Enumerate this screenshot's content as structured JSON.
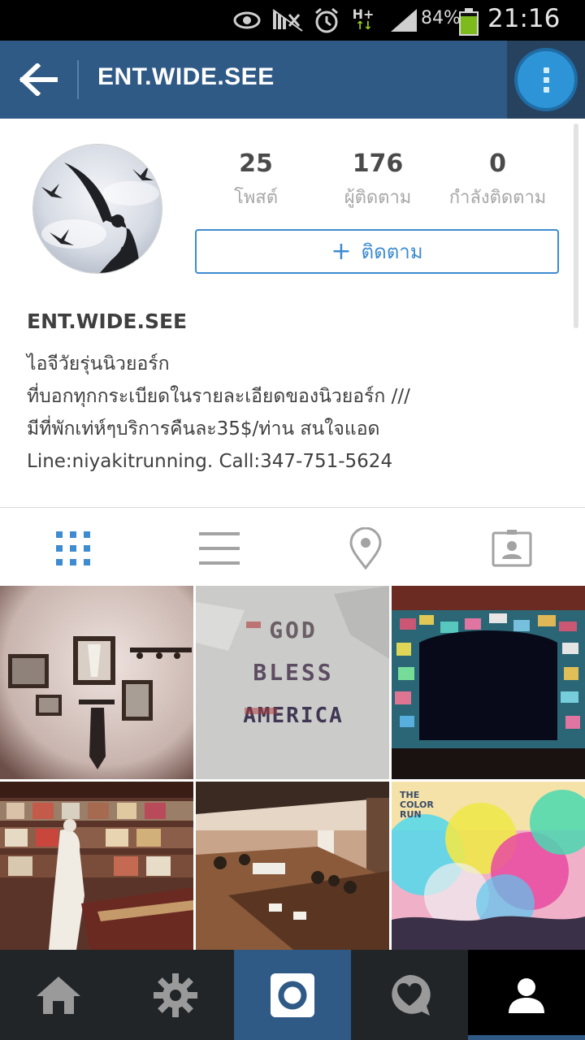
{
  "status_bar": {
    "network": "H+",
    "battery_percent": "84%",
    "battery_level": 0.84,
    "time": "21:16"
  },
  "header": {
    "title": "ENT.WIDE.SEE",
    "back_icon": "arrow-left-icon",
    "menu_icon": "more-vert-icon",
    "color": "#2f5a86"
  },
  "profile": {
    "stats": {
      "posts_count": "25",
      "posts_label": "โพสต์",
      "followers_count": "176",
      "followers_label": "ผู้ติดตาม",
      "following_count": "0",
      "following_label": "กำลังติดตาม"
    },
    "follow_button": {
      "icon": "+",
      "label": "ติดตาม"
    },
    "name": "ENT.WIDE.SEE",
    "bio": [
      "ไอจีวัยรุ่นนิวยอร์ก",
      "ที่บอกทุกกระเบียดในรายละเอียดของนิวยอร์ก ///",
      "มีที่พักเท่ห์ๆบริการคืนละ35$/ท่าน สนใจแอด",
      "Line:niyakitrunning. Call:347-751-5624"
    ],
    "accent_color": "#3d8bd0"
  },
  "tabs": [
    {
      "icon": "grid-icon",
      "selected": true
    },
    {
      "icon": "list-icon",
      "selected": false
    },
    {
      "icon": "map-pin-icon",
      "selected": false
    },
    {
      "icon": "tagged-photos-icon",
      "selected": false
    }
  ],
  "grid": {
    "post_2_text": [
      "GOD",
      "BLESS",
      "AMERICA"
    ],
    "post_6_text": [
      "THE",
      "COLOR",
      "RUN"
    ]
  },
  "bottom_nav": [
    {
      "icon": "home-icon"
    },
    {
      "icon": "explore-icon"
    },
    {
      "icon": "camera-icon"
    },
    {
      "icon": "activity-heart-icon"
    },
    {
      "icon": "profile-icon",
      "selected": true
    }
  ]
}
